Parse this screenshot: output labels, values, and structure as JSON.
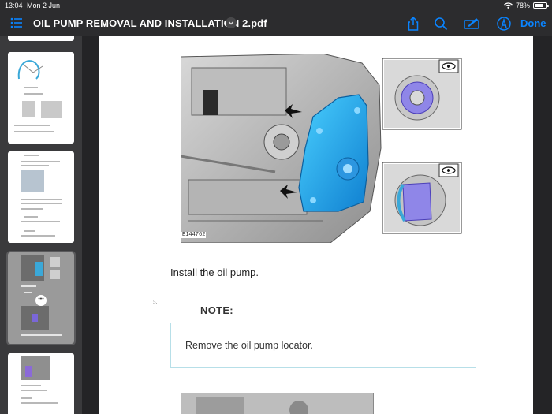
{
  "status_bar": {
    "time": "13:04",
    "date": "Mon 2 Jun",
    "battery": "78%",
    "battery_level": 0.78
  },
  "toolbar": {
    "title": "OIL PUMP REMOVAL AND INSTALLATION 2.pdf",
    "done_label": "Done",
    "accent_color": "#0a84ff",
    "icons": [
      "list-icon",
      "chevron-down-icon",
      "share-icon",
      "search-icon",
      "markup-icon",
      "pencil-circle-icon"
    ]
  },
  "sidebar": {
    "more_label": "•••"
  },
  "document": {
    "figure_id": "E144762",
    "step_caption": "Install the oil pump.",
    "step_number": "5.",
    "note_label": "NOTE:",
    "note_text": "Remove the oil pump locator."
  }
}
